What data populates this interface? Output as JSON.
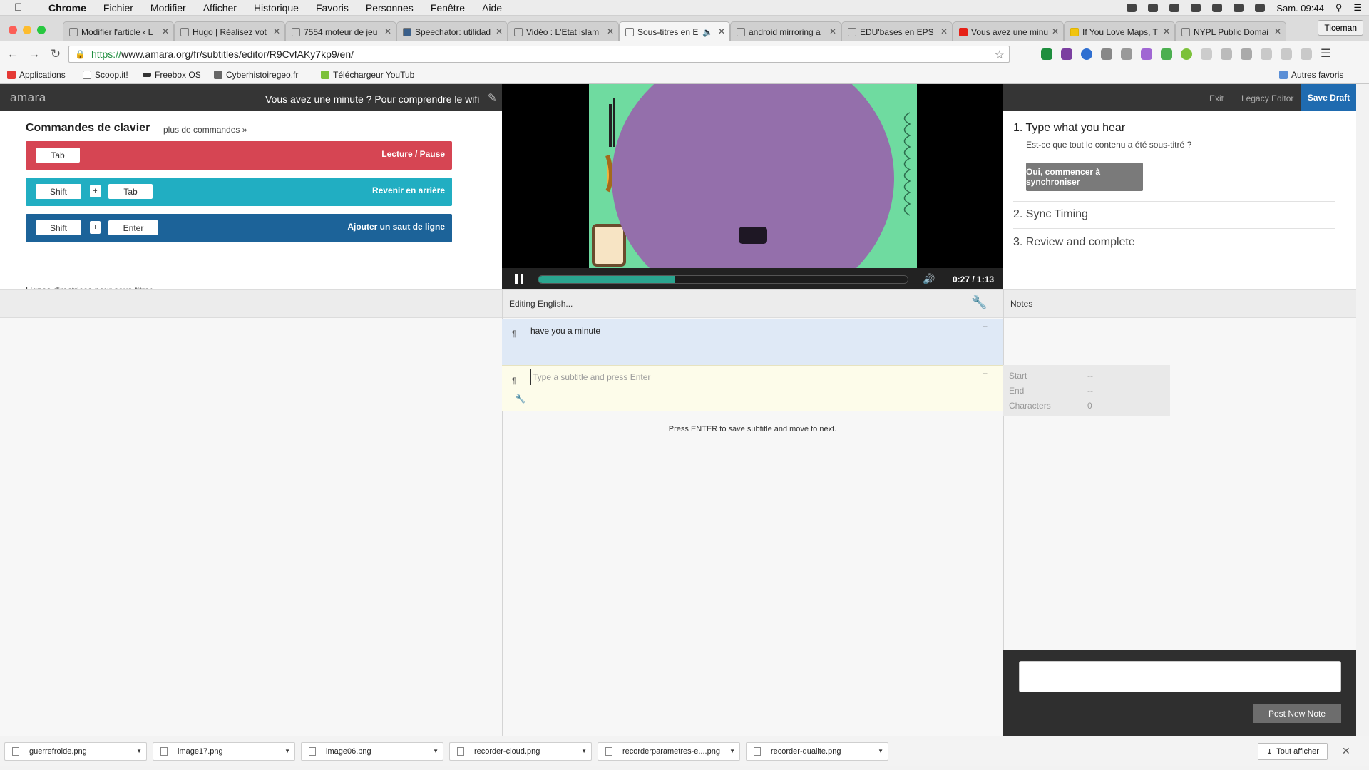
{
  "menubar": {
    "app": "Chrome",
    "items": [
      "Fichier",
      "Modifier",
      "Afficher",
      "Historique",
      "Favoris",
      "Personnes",
      "Fenêtre",
      "Aide"
    ],
    "clock": "Sam. 09:44"
  },
  "tabs": [
    {
      "label": "Modifier l'article ‹ L"
    },
    {
      "label": "Hugo | Réalisez vot"
    },
    {
      "label": "7554 moteur de jeu"
    },
    {
      "label": "Speechator: utilidad"
    },
    {
      "label": "Vidéo : L'Etat islam"
    },
    {
      "label": "Sous-titres en E"
    },
    {
      "label": "android mirroring a"
    },
    {
      "label": "EDU'bases en EPS"
    },
    {
      "label": "Vous avez une minu"
    },
    {
      "label": "If You Love Maps, T"
    },
    {
      "label": "NYPL Public Domai"
    }
  ],
  "profile": "Ticeman",
  "address": {
    "scheme": "https://",
    "host": "www.amara.org",
    "path": "/fr/subtitles/editor/R9CvfAKy7kp9/en/"
  },
  "bookmarks": [
    "Applications",
    "Scoop.it!",
    "Freebox OS",
    "Cyberhistoiregeo.fr",
    "Téléchargeur YouTub",
    "Autres favoris"
  ],
  "amara": {
    "logo": "amara",
    "video_title": "Vous avez une minute ? Pour comprendre le wifi",
    "keyboard": {
      "title": "Commandes de clavier",
      "more": "plus de commandes »",
      "rows": [
        {
          "keys": [
            "Tab"
          ],
          "action": "Lecture / Pause",
          "color": "#d64553"
        },
        {
          "keys": [
            "Shift",
            "+",
            "Tab"
          ],
          "action": "Revenir en arrière",
          "color": "#21aec2"
        },
        {
          "keys": [
            "Shift",
            "+",
            "Enter"
          ],
          "action": "Ajouter un saut de ligne",
          "color": "#1c6399"
        }
      ],
      "guidelines": "Lignes directrices pour sous-titrer »"
    },
    "player": {
      "time": "0:27 / 1:13",
      "progress": 0.37
    },
    "header_links": {
      "exit": "Exit",
      "legacy": "Legacy Editor",
      "save": "Save Draft"
    },
    "steps": {
      "step1": "1. Type what you hear",
      "question": "Est-ce que tout le contenu a été sous-titré ?",
      "sync_button": "Oui, commencer à synchroniser",
      "step2": "2. Sync Timing",
      "step3": "3. Review and complete"
    },
    "editing_label": "Editing English...",
    "notes_label": "Notes",
    "subtitles": [
      {
        "text": "have you a minute",
        "dash": "--"
      }
    ],
    "new_subtitle": {
      "placeholder": "Type a subtitle and press Enter",
      "dash": "--"
    },
    "help": "Press ENTER to save subtitle and move to next.",
    "timing": {
      "start_label": "Start",
      "start_value": "--",
      "end_label": "End",
      "end_value": "--",
      "chars_label": "Characters",
      "chars_value": "0"
    },
    "post_note": "Post New Note"
  },
  "downloads": [
    "guerrefroide.png",
    "image17.png",
    "image06.png",
    "recorder-cloud.png",
    "recorderparametres-e....png",
    "recorder-qualite.png"
  ],
  "show_all": "Tout afficher"
}
